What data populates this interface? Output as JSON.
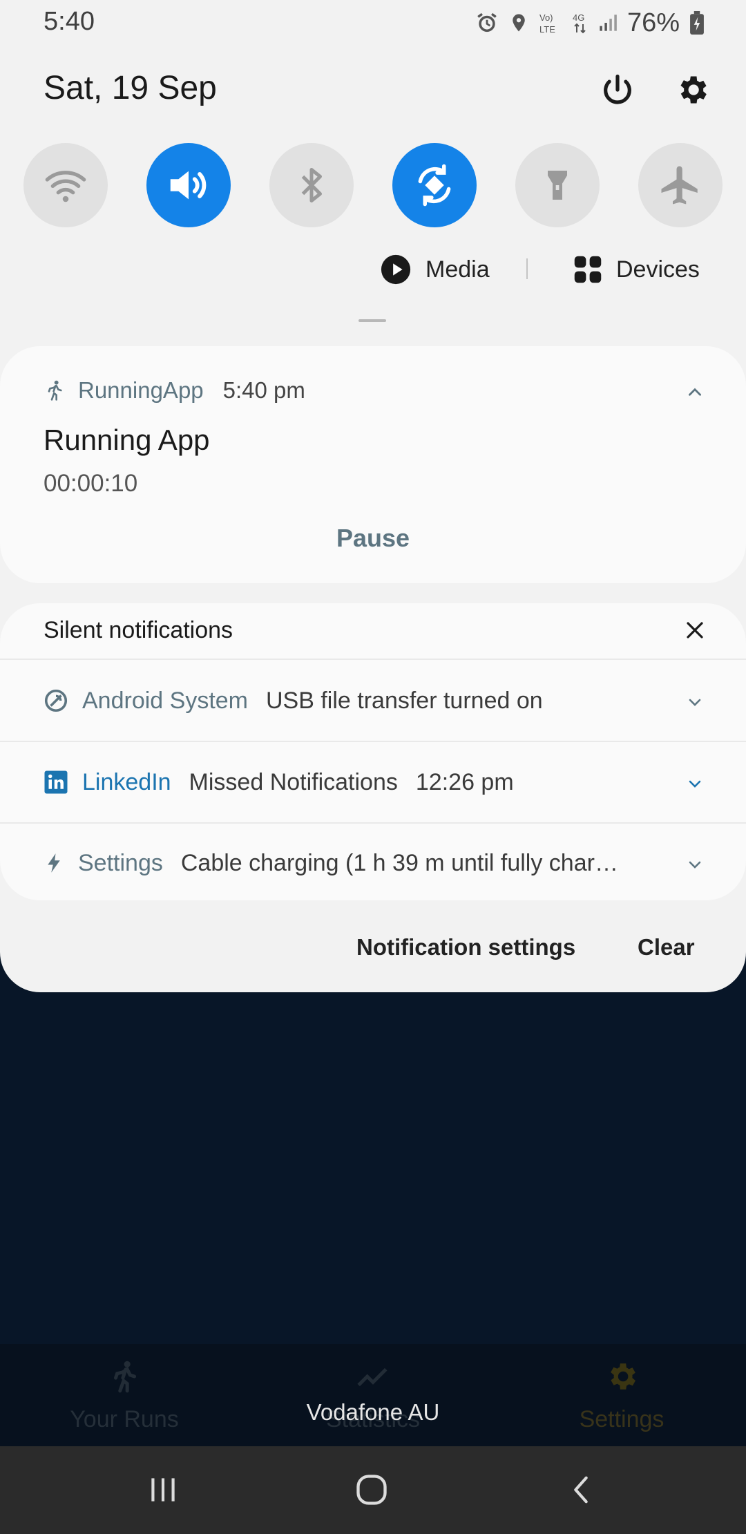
{
  "status_bar": {
    "time": "5:40",
    "battery": "76%",
    "icons": [
      "alarm-icon",
      "location-icon",
      "volte-icon",
      "4g-icon",
      "signal-icon",
      "battery-icon"
    ]
  },
  "header": {
    "date": "Sat, 19 Sep"
  },
  "quick_settings": {
    "tiles": [
      {
        "name": "wifi",
        "active": false
      },
      {
        "name": "sound",
        "active": true
      },
      {
        "name": "bluetooth",
        "active": false
      },
      {
        "name": "auto-rotate",
        "active": true
      },
      {
        "name": "flashlight",
        "active": false
      },
      {
        "name": "airplane-mode",
        "active": false
      }
    ],
    "media_label": "Media",
    "devices_label": "Devices"
  },
  "running_notification": {
    "app": "RunningApp",
    "time": "5:40 pm",
    "title": "Running App",
    "elapsed": "00:00:10",
    "action": "Pause"
  },
  "silent": {
    "title": "Silent notifications",
    "items": [
      {
        "app": "Android System",
        "message": "USB file transfer turned on",
        "time": ""
      },
      {
        "app": "LinkedIn",
        "message": "Missed Notifications",
        "time": "12:26 pm"
      },
      {
        "app": "Settings",
        "message": "Cable charging (1 h 39 m until fully char…",
        "time": ""
      }
    ]
  },
  "footer": {
    "notification_settings": "Notification settings",
    "clear": "Clear"
  },
  "app_nav": {
    "items": [
      "Your Runs",
      "Statistics",
      "Settings"
    ]
  },
  "carrier": "Vodafone AU",
  "colors": {
    "accent": "#1483e8",
    "app_text": "#5d7581",
    "linkedin": "#1b74b0",
    "background": "#081628"
  }
}
